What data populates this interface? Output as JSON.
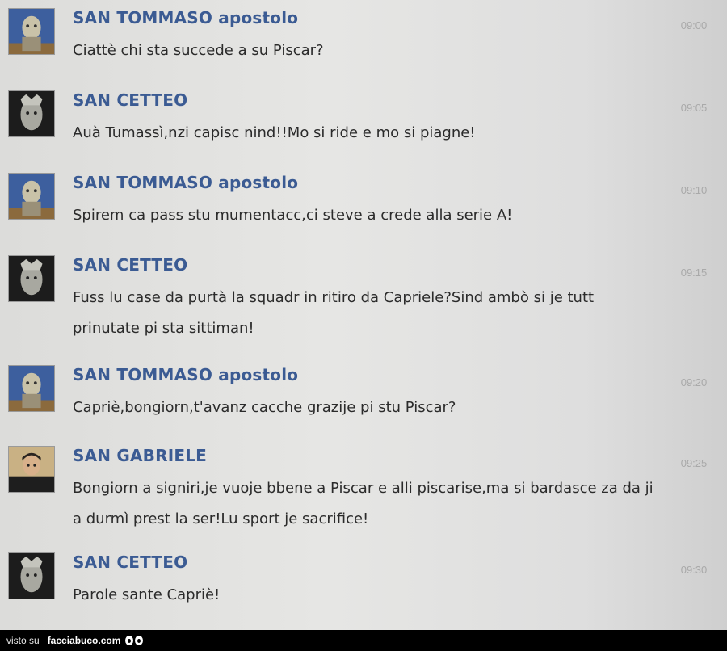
{
  "messages": [
    {
      "sender": "SAN TOMMASO apostolo",
      "avatar": "tommaso-avatar",
      "text": "Ciattè chi sta succede a su Piscar?",
      "time": "09:00"
    },
    {
      "sender": "SAN CETTEO",
      "avatar": "cetteo-avatar",
      "text": "Auà Tumassì,nzi capisc nind!!Mo si ride e mo si piagne!",
      "time": "09:05"
    },
    {
      "sender": "SAN TOMMASO apostolo",
      "avatar": "tommaso-avatar",
      "text": "Spirem ca pass stu mumentacc,ci steve a crede alla serie A!",
      "time": "09:10"
    },
    {
      "sender": "SAN CETTEO",
      "avatar": "cetteo-avatar",
      "text": "Fuss lu case da purtà la squadr in ritiro da Capriele?Sind ambò si je tutt prinutate pi sta sittiman!",
      "time": "09:15"
    },
    {
      "sender": "SAN TOMMASO apostolo",
      "avatar": "tommaso-avatar",
      "text": "Capriè,bongiorn,t'avanz cacche grazije pi stu Piscar?",
      "time": "09:20"
    },
    {
      "sender": "SAN GABRIELE",
      "avatar": "gabriele-avatar",
      "text": "Bongiorn a signiri,je vuoje bbene a Piscar e alli piscarise,ma si bardasce za da ji a durmì prest la ser!Lu sport je sacrifice!",
      "time": "09:25"
    },
    {
      "sender": "SAN CETTEO",
      "avatar": "cetteo-avatar",
      "text": "Parole sante Capriè!",
      "time": "09:30"
    }
  ],
  "footer": {
    "visto": "visto su",
    "brand": "facciabuco.com"
  },
  "colors": {
    "sender": "#3b5b93",
    "text": "#2b2b2b",
    "time": "#a9a9a9"
  }
}
